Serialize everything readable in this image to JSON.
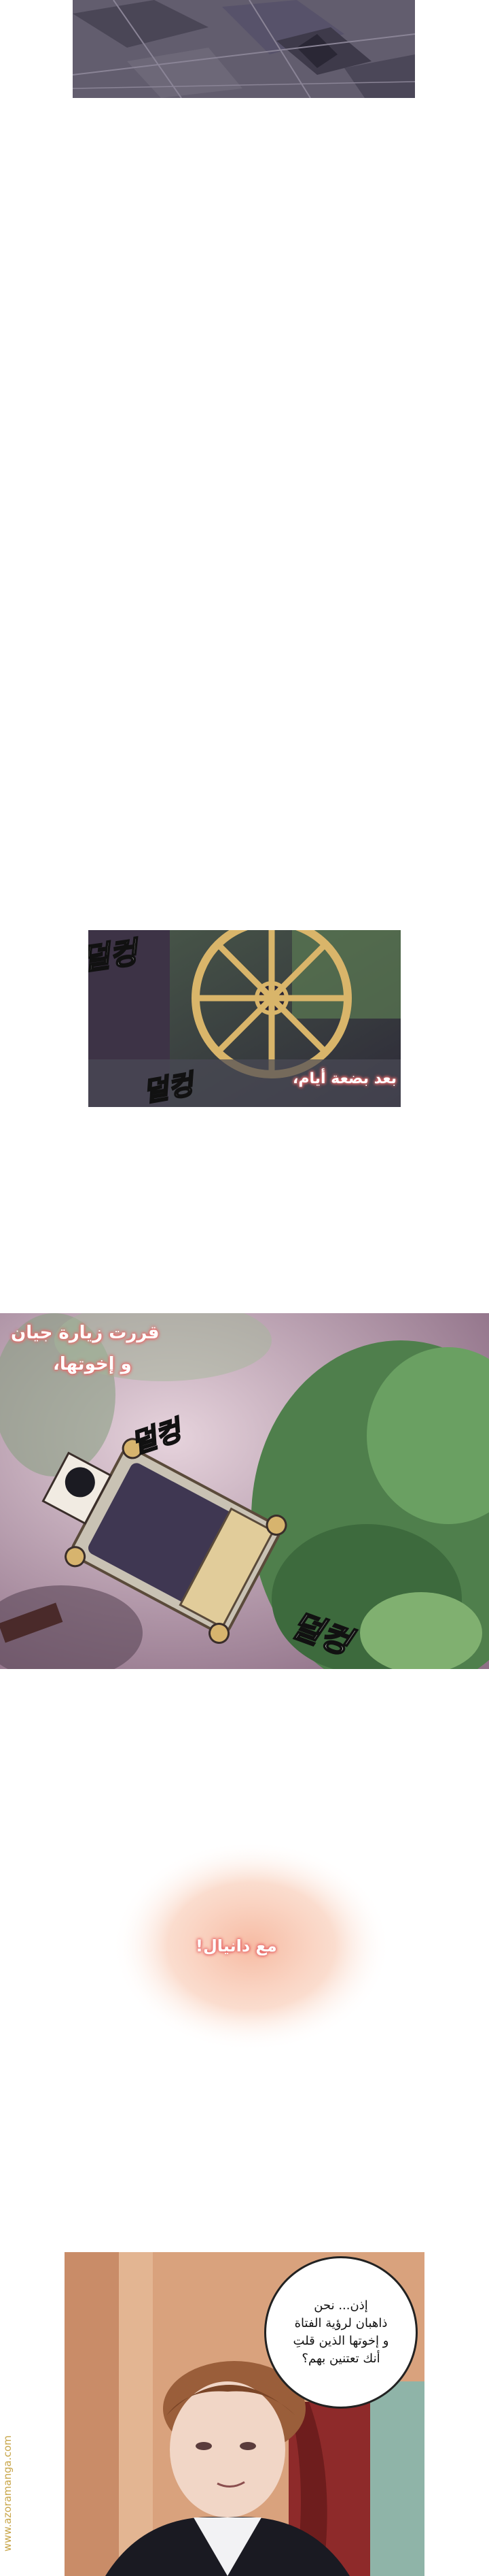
{
  "panels": {
    "floor": {},
    "carriage_wheel": {
      "sfx_top": "덜컹",
      "sfx_bottom": "덜컹",
      "caption": "بعد بضعة أيام،"
    },
    "carriage_top": {
      "caption_line1": "قررت زيارة جيان",
      "caption_line2": "و إخوتها،",
      "sfx_mid": "덜컹",
      "sfx_bottom": "덜컹"
    },
    "glow": {
      "caption": "مع دانيال!"
    },
    "man": {
      "bubble_text": "إذن... نحن\nذاهبان لرؤية الفتاة\nو إخوتها الذين قلتِ\nأنك تعتنين بهم؟"
    }
  },
  "watermark": "www.azoramanga.com",
  "colors": {
    "caption_outline": "#e86a6a",
    "glow": "#f8c6ae",
    "carriage_body": "#3f3752",
    "foliage": "#5e9a5a",
    "watermark": "#c8a64a"
  }
}
